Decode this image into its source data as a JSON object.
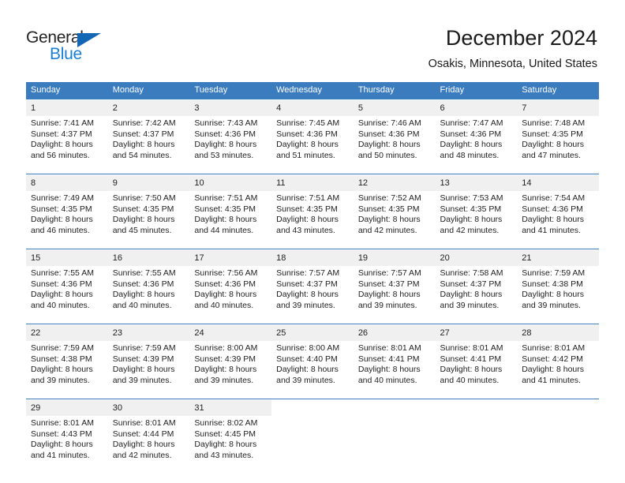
{
  "logo": {
    "text_top": "General",
    "text_bottom": "Blue",
    "triangle_icon": "triangle-icon",
    "color_top": "#232323",
    "color_bottom": "#1a7fd4",
    "triangle_color": "#1266b3"
  },
  "header": {
    "title": "December 2024",
    "subtitle": "Osakis, Minnesota, United States"
  },
  "theme": {
    "header_bg": "#3a7cbe",
    "daynum_bg": "#f0f0f0",
    "separator": "#3a7cbe",
    "text": "#222222"
  },
  "weekday_headers": [
    "Sunday",
    "Monday",
    "Tuesday",
    "Wednesday",
    "Thursday",
    "Friday",
    "Saturday"
  ],
  "weeks": [
    {
      "days": [
        {
          "num": "1",
          "sunrise": "Sunrise: 7:41 AM",
          "sunset": "Sunset: 4:37 PM",
          "daylight1": "Daylight: 8 hours",
          "daylight2": "and 56 minutes."
        },
        {
          "num": "2",
          "sunrise": "Sunrise: 7:42 AM",
          "sunset": "Sunset: 4:37 PM",
          "daylight1": "Daylight: 8 hours",
          "daylight2": "and 54 minutes."
        },
        {
          "num": "3",
          "sunrise": "Sunrise: 7:43 AM",
          "sunset": "Sunset: 4:36 PM",
          "daylight1": "Daylight: 8 hours",
          "daylight2": "and 53 minutes."
        },
        {
          "num": "4",
          "sunrise": "Sunrise: 7:45 AM",
          "sunset": "Sunset: 4:36 PM",
          "daylight1": "Daylight: 8 hours",
          "daylight2": "and 51 minutes."
        },
        {
          "num": "5",
          "sunrise": "Sunrise: 7:46 AM",
          "sunset": "Sunset: 4:36 PM",
          "daylight1": "Daylight: 8 hours",
          "daylight2": "and 50 minutes."
        },
        {
          "num": "6",
          "sunrise": "Sunrise: 7:47 AM",
          "sunset": "Sunset: 4:36 PM",
          "daylight1": "Daylight: 8 hours",
          "daylight2": "and 48 minutes."
        },
        {
          "num": "7",
          "sunrise": "Sunrise: 7:48 AM",
          "sunset": "Sunset: 4:35 PM",
          "daylight1": "Daylight: 8 hours",
          "daylight2": "and 47 minutes."
        }
      ]
    },
    {
      "days": [
        {
          "num": "8",
          "sunrise": "Sunrise: 7:49 AM",
          "sunset": "Sunset: 4:35 PM",
          "daylight1": "Daylight: 8 hours",
          "daylight2": "and 46 minutes."
        },
        {
          "num": "9",
          "sunrise": "Sunrise: 7:50 AM",
          "sunset": "Sunset: 4:35 PM",
          "daylight1": "Daylight: 8 hours",
          "daylight2": "and 45 minutes."
        },
        {
          "num": "10",
          "sunrise": "Sunrise: 7:51 AM",
          "sunset": "Sunset: 4:35 PM",
          "daylight1": "Daylight: 8 hours",
          "daylight2": "and 44 minutes."
        },
        {
          "num": "11",
          "sunrise": "Sunrise: 7:51 AM",
          "sunset": "Sunset: 4:35 PM",
          "daylight1": "Daylight: 8 hours",
          "daylight2": "and 43 minutes."
        },
        {
          "num": "12",
          "sunrise": "Sunrise: 7:52 AM",
          "sunset": "Sunset: 4:35 PM",
          "daylight1": "Daylight: 8 hours",
          "daylight2": "and 42 minutes."
        },
        {
          "num": "13",
          "sunrise": "Sunrise: 7:53 AM",
          "sunset": "Sunset: 4:35 PM",
          "daylight1": "Daylight: 8 hours",
          "daylight2": "and 42 minutes."
        },
        {
          "num": "14",
          "sunrise": "Sunrise: 7:54 AM",
          "sunset": "Sunset: 4:36 PM",
          "daylight1": "Daylight: 8 hours",
          "daylight2": "and 41 minutes."
        }
      ]
    },
    {
      "days": [
        {
          "num": "15",
          "sunrise": "Sunrise: 7:55 AM",
          "sunset": "Sunset: 4:36 PM",
          "daylight1": "Daylight: 8 hours",
          "daylight2": "and 40 minutes."
        },
        {
          "num": "16",
          "sunrise": "Sunrise: 7:55 AM",
          "sunset": "Sunset: 4:36 PM",
          "daylight1": "Daylight: 8 hours",
          "daylight2": "and 40 minutes."
        },
        {
          "num": "17",
          "sunrise": "Sunrise: 7:56 AM",
          "sunset": "Sunset: 4:36 PM",
          "daylight1": "Daylight: 8 hours",
          "daylight2": "and 40 minutes."
        },
        {
          "num": "18",
          "sunrise": "Sunrise: 7:57 AM",
          "sunset": "Sunset: 4:37 PM",
          "daylight1": "Daylight: 8 hours",
          "daylight2": "and 39 minutes."
        },
        {
          "num": "19",
          "sunrise": "Sunrise: 7:57 AM",
          "sunset": "Sunset: 4:37 PM",
          "daylight1": "Daylight: 8 hours",
          "daylight2": "and 39 minutes."
        },
        {
          "num": "20",
          "sunrise": "Sunrise: 7:58 AM",
          "sunset": "Sunset: 4:37 PM",
          "daylight1": "Daylight: 8 hours",
          "daylight2": "and 39 minutes."
        },
        {
          "num": "21",
          "sunrise": "Sunrise: 7:59 AM",
          "sunset": "Sunset: 4:38 PM",
          "daylight1": "Daylight: 8 hours",
          "daylight2": "and 39 minutes."
        }
      ]
    },
    {
      "days": [
        {
          "num": "22",
          "sunrise": "Sunrise: 7:59 AM",
          "sunset": "Sunset: 4:38 PM",
          "daylight1": "Daylight: 8 hours",
          "daylight2": "and 39 minutes."
        },
        {
          "num": "23",
          "sunrise": "Sunrise: 7:59 AM",
          "sunset": "Sunset: 4:39 PM",
          "daylight1": "Daylight: 8 hours",
          "daylight2": "and 39 minutes."
        },
        {
          "num": "24",
          "sunrise": "Sunrise: 8:00 AM",
          "sunset": "Sunset: 4:39 PM",
          "daylight1": "Daylight: 8 hours",
          "daylight2": "and 39 minutes."
        },
        {
          "num": "25",
          "sunrise": "Sunrise: 8:00 AM",
          "sunset": "Sunset: 4:40 PM",
          "daylight1": "Daylight: 8 hours",
          "daylight2": "and 39 minutes."
        },
        {
          "num": "26",
          "sunrise": "Sunrise: 8:01 AM",
          "sunset": "Sunset: 4:41 PM",
          "daylight1": "Daylight: 8 hours",
          "daylight2": "and 40 minutes."
        },
        {
          "num": "27",
          "sunrise": "Sunrise: 8:01 AM",
          "sunset": "Sunset: 4:41 PM",
          "daylight1": "Daylight: 8 hours",
          "daylight2": "and 40 minutes."
        },
        {
          "num": "28",
          "sunrise": "Sunrise: 8:01 AM",
          "sunset": "Sunset: 4:42 PM",
          "daylight1": "Daylight: 8 hours",
          "daylight2": "and 41 minutes."
        }
      ]
    },
    {
      "days": [
        {
          "num": "29",
          "sunrise": "Sunrise: 8:01 AM",
          "sunset": "Sunset: 4:43 PM",
          "daylight1": "Daylight: 8 hours",
          "daylight2": "and 41 minutes."
        },
        {
          "num": "30",
          "sunrise": "Sunrise: 8:01 AM",
          "sunset": "Sunset: 4:44 PM",
          "daylight1": "Daylight: 8 hours",
          "daylight2": "and 42 minutes."
        },
        {
          "num": "31",
          "sunrise": "Sunrise: 8:02 AM",
          "sunset": "Sunset: 4:45 PM",
          "daylight1": "Daylight: 8 hours",
          "daylight2": "and 43 minutes."
        },
        {
          "num": "",
          "sunrise": "",
          "sunset": "",
          "daylight1": "",
          "daylight2": ""
        },
        {
          "num": "",
          "sunrise": "",
          "sunset": "",
          "daylight1": "",
          "daylight2": ""
        },
        {
          "num": "",
          "sunrise": "",
          "sunset": "",
          "daylight1": "",
          "daylight2": ""
        },
        {
          "num": "",
          "sunrise": "",
          "sunset": "",
          "daylight1": "",
          "daylight2": ""
        }
      ]
    }
  ]
}
